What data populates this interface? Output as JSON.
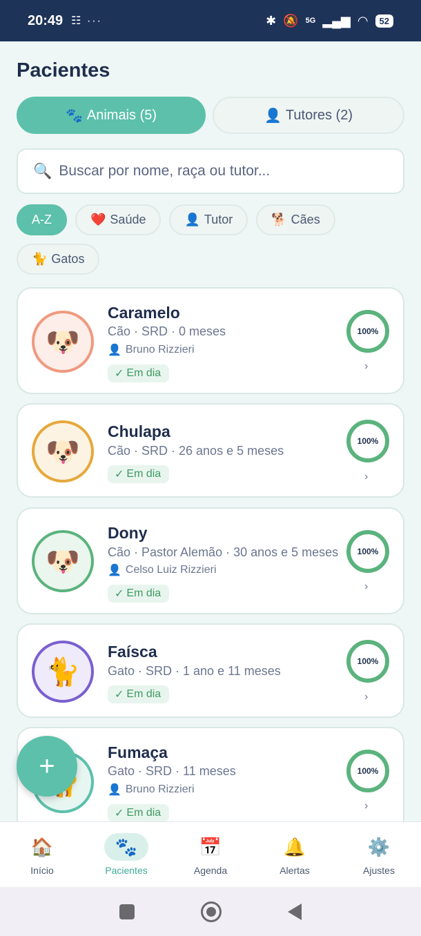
{
  "status_bar": {
    "time": "20:49",
    "left_icons": "☷ ···",
    "signal": "5G",
    "battery": "52"
  },
  "page_title": "Pacientes",
  "tabs": [
    {
      "icon": "🐾",
      "label": "Animais (5)",
      "active": true
    },
    {
      "icon": "👤",
      "label": "Tutores (2)",
      "active": false
    }
  ],
  "search": {
    "icon": "🔍",
    "placeholder": "Buscar por nome, raça ou tutor..."
  },
  "chips": [
    {
      "icon": "",
      "label": "A-Z",
      "active": true
    },
    {
      "icon": "❤️",
      "label": "Saúde",
      "active": false
    },
    {
      "icon": "👤",
      "label": "Tutor",
      "active": false
    },
    {
      "icon": "🐕",
      "label": "Cães",
      "active": false
    },
    {
      "icon": "🐈",
      "label": "Gatos",
      "active": false
    }
  ],
  "patients": [
    {
      "name": "Caramelo",
      "meta": "Cão · SRD · 0 meses",
      "tutor": "Bruno Rizzieri",
      "status": "Em dia",
      "health": "100%",
      "avatar": "🐶",
      "ring_color": "#ef9a80",
      "ring_bg": "#fdeee9"
    },
    {
      "name": "Chulapa",
      "meta": "Cão · SRD · 26 anos e 5 meses",
      "tutor": "",
      "status": "Em dia",
      "health": "100%",
      "avatar": "🐶",
      "ring_color": "#e6a83c",
      "ring_bg": "#fdf3e3"
    },
    {
      "name": "Dony",
      "meta": "Cão · Pastor Alemão · 30 anos e 5 meses",
      "tutor": "Celso Luiz Rizzieri",
      "status": "Em dia",
      "health": "100%",
      "avatar": "🐶",
      "ring_color": "#5bb37d",
      "ring_bg": "#eaf6ee"
    },
    {
      "name": "Faísca",
      "meta": "Gato · SRD · 1 ano e 11 meses",
      "tutor": "",
      "status": "Em dia",
      "health": "100%",
      "avatar": "🐈",
      "ring_color": "#7a5fd0",
      "ring_bg": "#efebfa"
    },
    {
      "name": "Fumaça",
      "meta": "Gato · SRD · 11 meses",
      "tutor": "Bruno Rizzieri",
      "status": "Em dia",
      "health": "100%",
      "avatar": "🐈",
      "ring_color": "#5cc0ab",
      "ring_bg": "#e8f6f2"
    }
  ],
  "fab_label": "+",
  "bottom_nav": [
    {
      "icon": "🏠",
      "label": "Início",
      "active": false
    },
    {
      "icon": "🐾",
      "label": "Pacientes",
      "active": true
    },
    {
      "icon": "📅",
      "label": "Agenda",
      "active": false
    },
    {
      "icon": "🔔",
      "label": "Alertas",
      "active": false
    },
    {
      "icon": "⚙️",
      "label": "Ajustes",
      "active": false
    }
  ],
  "badge_check": "✓",
  "chevron": "›",
  "tutor_icon": "👤"
}
